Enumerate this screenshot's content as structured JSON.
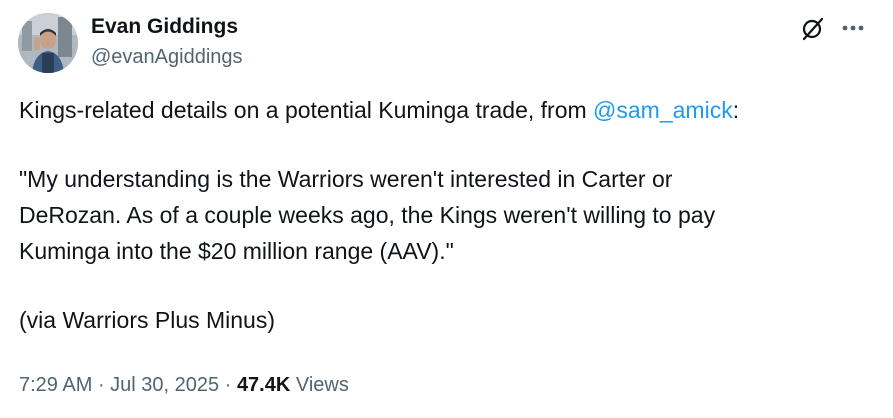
{
  "author": {
    "display_name": "Evan Giddings",
    "handle": "@evanAgiddings",
    "avatar_icon": "user-avatar-photo"
  },
  "header": {
    "grok_icon": "grok-slash-icon",
    "more_icon": "more-horizontal-icon"
  },
  "tweet": {
    "line1_prefix": "Kings-related details on a potential Kuminga trade, from ",
    "line1_mention": "@sam_amick",
    "line1_suffix": ":",
    "quote_line1": "\"My understanding is the Warriors weren't interested in Carter or",
    "quote_line2": "DeRozan. As of a couple weeks ago, the Kings weren't willing to pay",
    "quote_line3": "Kuminga into the $20 million range (AAV).\"",
    "source": "(via Warriors Plus Minus)"
  },
  "meta": {
    "time": "7:29 AM",
    "separator": " · ",
    "date": "Jul 30, 2025",
    "views_count": "47.4K",
    "views_label": "Views"
  },
  "colors": {
    "text": "#0f1419",
    "secondary": "#536471",
    "link": "#1d9bf0"
  }
}
